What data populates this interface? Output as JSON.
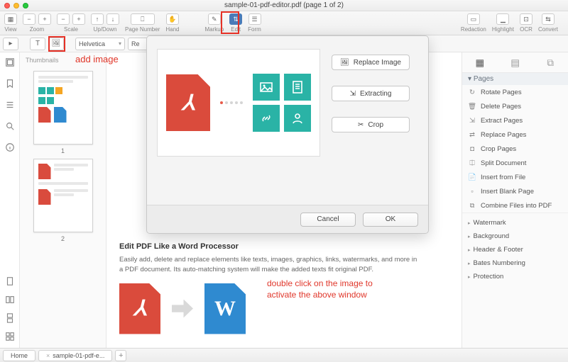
{
  "window": {
    "title": "sample-01-pdf-editor.pdf (page 1 of 2)"
  },
  "toolbar": {
    "view": "View",
    "zoom": "Zoom",
    "scale": "Scale",
    "updown": "Up/Down",
    "pagenum": "Page Number",
    "hand": "Hand",
    "markup": "Markup",
    "edit": "Edit",
    "form": "Form",
    "redaction": "Redaction",
    "highlight": "Highlight",
    "ocr": "OCR",
    "convert": "Convert"
  },
  "secbar": {
    "font": "Helvetica",
    "regular_short": "Re"
  },
  "annotations": {
    "add_image": "add image",
    "dblclick_line1": "double click on the image to",
    "dblclick_line2": "activate the above window"
  },
  "thumbnails": {
    "header": "Thumbnails",
    "p1": "1",
    "p2": "2"
  },
  "document": {
    "heading": "Edit PDF Like a Word Processor",
    "paragraph": "Easily add, delete and replace elements like texts, images, graphics, links, watermarks, and more in a PDF document. Its auto-matching system will make the added texts fit original PDF."
  },
  "dialog": {
    "replace": "Replace Image",
    "extracting": "Extracting",
    "crop": "Crop",
    "cancel": "Cancel",
    "ok": "OK"
  },
  "rightpanel": {
    "section": "Pages",
    "items": [
      "Rotate Pages",
      "Delete Pages",
      "Extract Pages",
      "Replace Pages",
      "Crop Pages",
      "Split Document",
      "Insert from File",
      "Insert Blank Page",
      "Combine Files into PDF"
    ],
    "extras": [
      "Watermark",
      "Background",
      "Header & Footer",
      "Bates Numbering",
      "Protection"
    ]
  },
  "tabs": {
    "home": "Home",
    "doc": "sample-01-pdf-e..."
  }
}
